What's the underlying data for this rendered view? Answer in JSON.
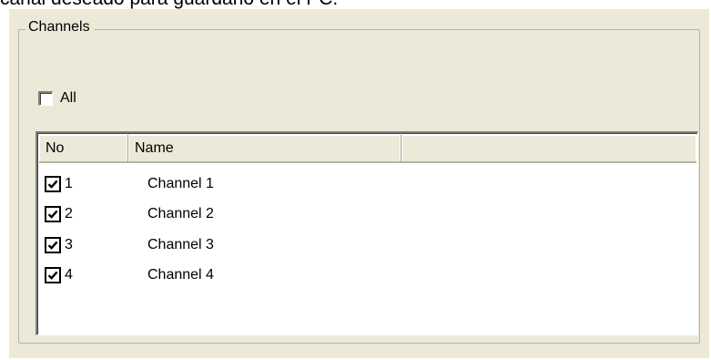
{
  "document": {
    "partial_text": "canal deseado para guardarlo en el PC."
  },
  "group": {
    "title": "Channels"
  },
  "all_checkbox": {
    "label": "All",
    "checked": false
  },
  "list": {
    "headers": {
      "no": "No",
      "name": "Name",
      "extra": ""
    },
    "rows": [
      {
        "no": "1",
        "name": "Channel 1",
        "checked": true
      },
      {
        "no": "2",
        "name": "Channel 2",
        "checked": true
      },
      {
        "no": "3",
        "name": "Channel 3",
        "checked": true
      },
      {
        "no": "4",
        "name": "Channel 4",
        "checked": true
      }
    ]
  }
}
